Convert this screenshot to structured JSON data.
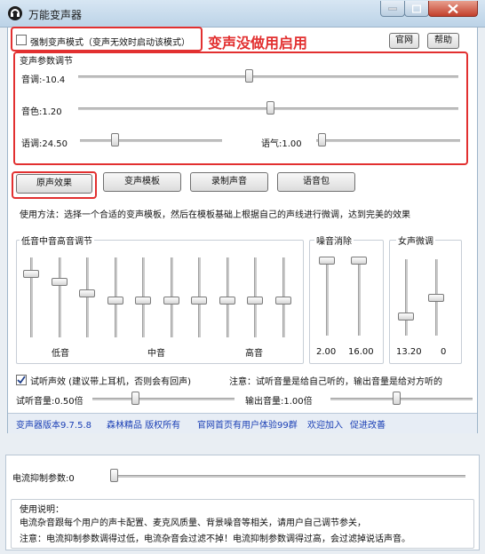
{
  "window": {
    "title": "万能变声器"
  },
  "top": {
    "strong_mode_label": "强制变声模式（变声无效时启动该模式）",
    "annotation": "变声没做用启用",
    "official_site": "官网",
    "help": "帮助"
  },
  "params": {
    "group_title": "变声参数调节",
    "pitch_label": "音调:-10.4",
    "timbre_label": "音色:1.20",
    "speed_label": "语调:24.50",
    "tone_label": "语气:1.00"
  },
  "buttons": {
    "original": "原声效果",
    "templates": "变声模板",
    "record": "录制声音",
    "voice_pack": "语音包"
  },
  "usage": "使用方法：选择一个合适的变声模板，然后在模板基础上根据自己的声线进行微调，达到完美的效果",
  "eq": {
    "title": "低音中音高音调节",
    "low": "低音",
    "mid": "中音",
    "high": "高音",
    "levels": [
      0.83,
      0.71,
      0.55,
      0.46,
      0.46,
      0.46,
      0.46,
      0.46,
      0.46,
      0.46
    ]
  },
  "noise": {
    "title": "噪音消除",
    "val1": "2.00",
    "val2": "16.00"
  },
  "female": {
    "title": "女声微调",
    "val1": "13.20",
    "val2": "0"
  },
  "monitor": {
    "label": "试听声效 (建议带上耳机，否则会有回声)",
    "note": "注意：试听音量是给自己听的，输出音量是给对方听的",
    "listen_volume": "试听音量:0.50倍",
    "output_volume": "输出音量:1.00倍"
  },
  "footer": {
    "version": "变声器版本9.7.5.8",
    "brand": "森林精品 版权所有",
    "official_notice": "官网首页有用户体验99群",
    "join": "欢迎加入",
    "improve": "促进改善"
  },
  "bottom": {
    "current_param_label": "电流抑制参数:0",
    "usage_title": "使用说明：",
    "line1": "电流杂音跟每个用户的声卡配置、麦克风质量、背景噪音等相关，请用户自己调节参关，",
    "line2": "注意：电流抑制参数调得过低，电流杂音会过滤不掉！电流抑制参数调得过高，会过滤掉说话声音。"
  }
}
